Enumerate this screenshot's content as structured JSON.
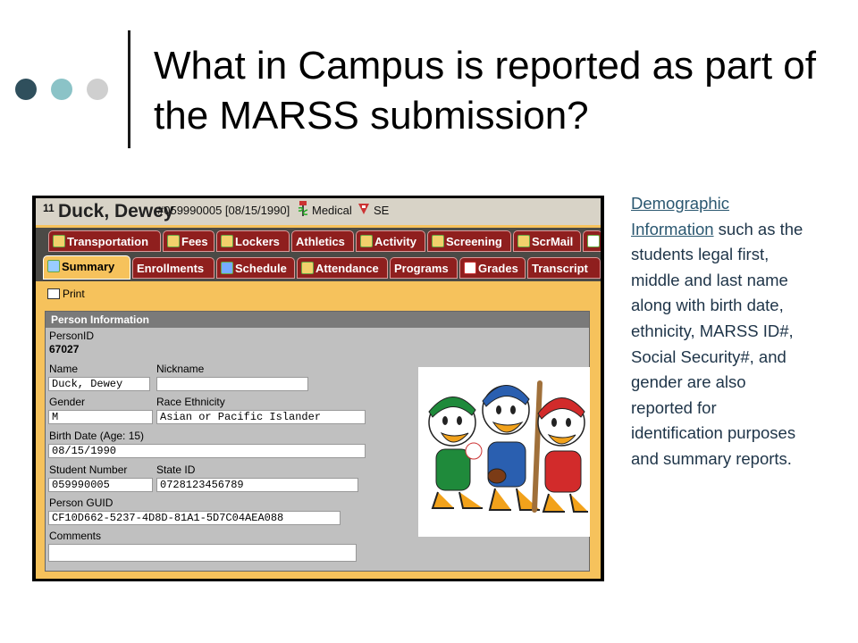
{
  "slide": {
    "title": "What in Campus is reported as part of the MARSS submission?",
    "dot_colors": [
      "#2f4f5c",
      "#8bc3c7",
      "#cfcfcf"
    ],
    "caption_link": "Demographic Information",
    "caption_rest": " such as the students legal first, middle and last name along with birth date, ethnicity, MARSS ID#, Social Security#, and gender are also reported for identification purposes and summary reports."
  },
  "app": {
    "header": {
      "num": "11",
      "student_name": "Duck, Dewey",
      "student_id_dob": "#059990005 [08/15/1990]",
      "medical": "Medical",
      "se": "SE"
    },
    "tabs_row1": [
      "Transportation",
      "Fees",
      "Lockers",
      "Athletics",
      "Activity",
      "Screening",
      "ScrMail"
    ],
    "tabs_row2": [
      "Summary",
      "Enrollments",
      "Schedule",
      "Attendance",
      "Programs",
      "Grades",
      "Transcript"
    ],
    "print_label": "Print",
    "person": {
      "section_title": "Person Information",
      "person_id_label": "PersonID",
      "person_id": "67027",
      "name_label": "Name",
      "name": "Duck, Dewey",
      "nickname_label": "Nickname",
      "nickname": "",
      "gender_label": "Gender",
      "gender": "M",
      "race_label": "Race Ethnicity",
      "race": "Asian or Pacific Islander",
      "birth_label": "Birth Date (Age: 15)",
      "birth": "08/15/1990",
      "student_number_label": "Student Number",
      "student_number": "059990005",
      "state_id_label": "State ID",
      "state_id": "0728123456789",
      "guid_label": "Person GUID",
      "guid": "CF10D662-5237-4D8D-81A1-5D7C04AEA088",
      "comments_label": "Comments",
      "comments": ""
    }
  }
}
